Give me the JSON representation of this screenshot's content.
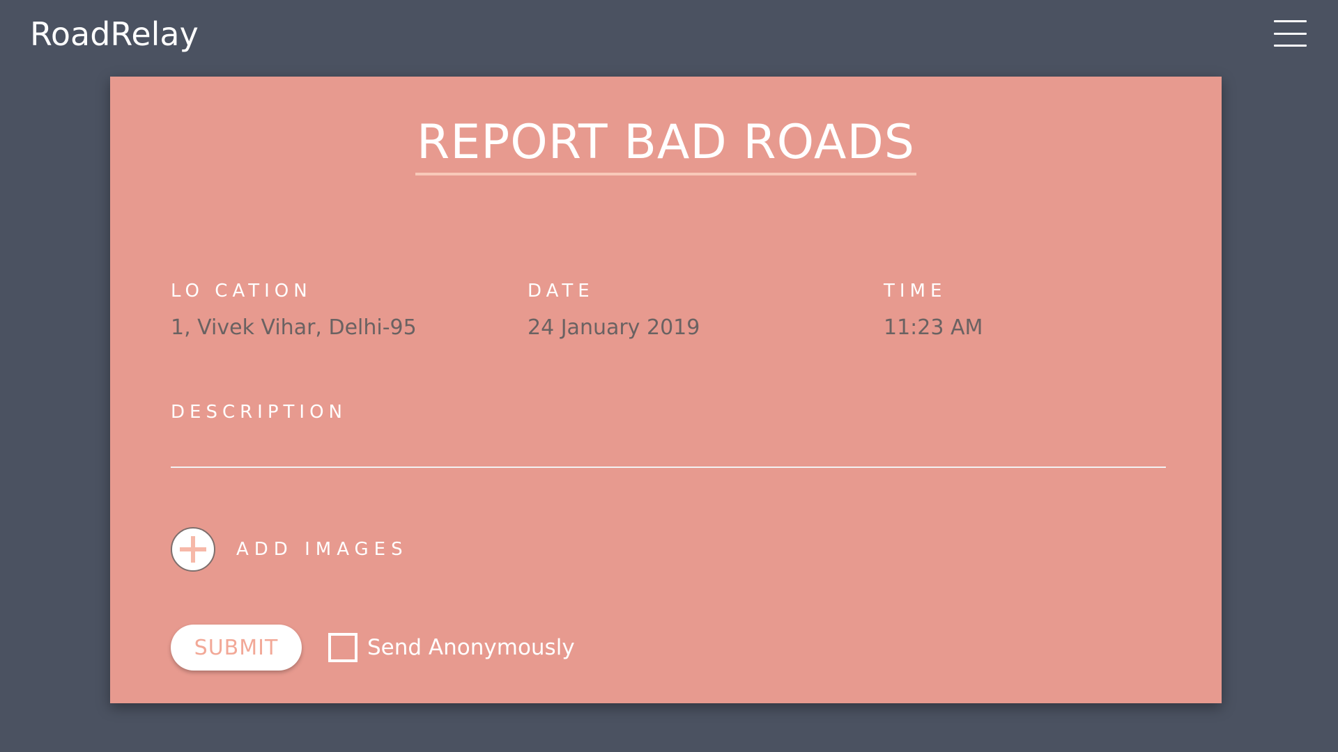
{
  "app": {
    "brand": "RoadRelay",
    "menu_icon": "hamburger-menu-icon"
  },
  "colors": {
    "page_background": "#4b5261",
    "card_background": "#e79a8f",
    "title_underline": "#f8c9b9",
    "value_text": "#6a6262",
    "accent": "#f2a897"
  },
  "form": {
    "title": "REPORT BAD ROADS",
    "location": {
      "label": "LO CATION",
      "value": "1, Vivek Vihar, Delhi-95"
    },
    "date": {
      "label": "DATE",
      "value": "24 January 2019"
    },
    "time": {
      "label": "TIME",
      "value": "11:23 AM"
    },
    "description": {
      "label": "DESCRIPTION",
      "value": "",
      "placeholder": ""
    },
    "add_images": {
      "label": "ADD IMAGES",
      "icon": "plus-circle-icon"
    },
    "submit_label": "SUBMIT",
    "anonymous": {
      "label": "Send Anonymously",
      "checked": false
    }
  }
}
